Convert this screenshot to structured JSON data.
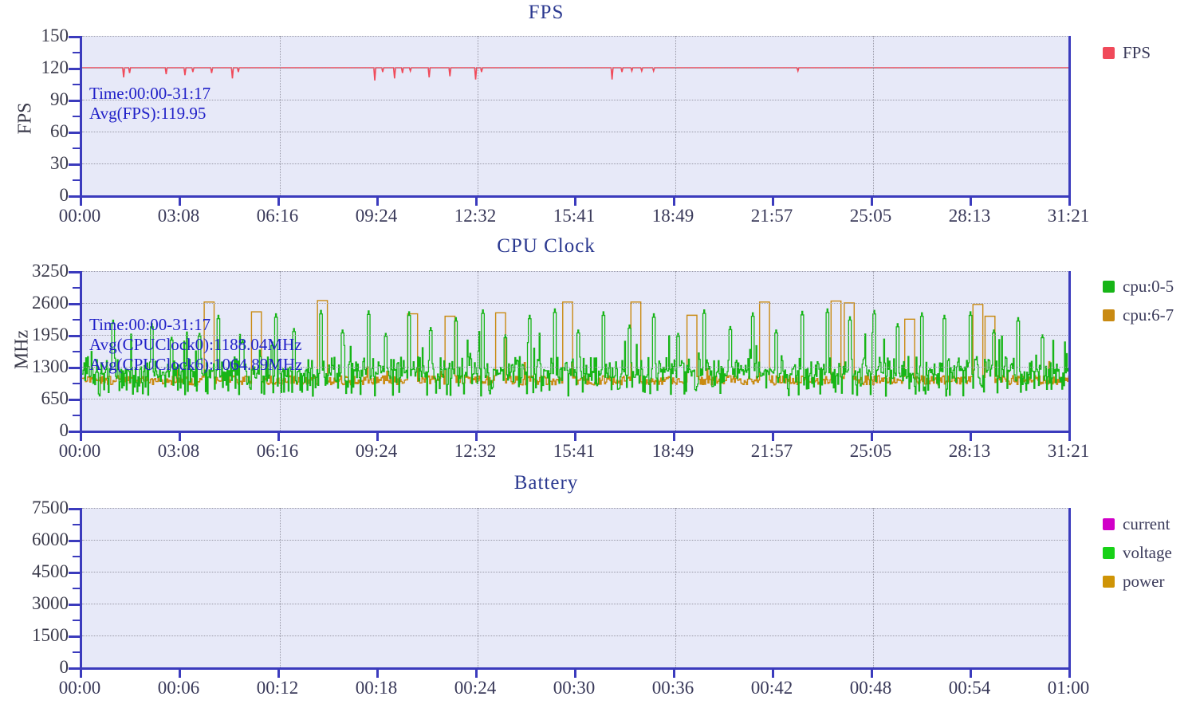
{
  "charts": [
    {
      "id": "fps",
      "title": "FPS",
      "ylabel": "FPS",
      "annotation": "Time:00:00-31:17\nAvg(FPS):119.95",
      "annotation_lines": [
        "Time:00:00-31:17",
        "Avg(FPS):119.95"
      ],
      "legend": [
        {
          "label": "FPS",
          "color": "#f04a5a"
        }
      ]
    },
    {
      "id": "cpu",
      "title": "CPU Clock",
      "ylabel": "MHz",
      "annotation": "Time:00:00-31:17\nAvg(CPUClock0):1188.04MHz\nAvg(CPUClock6):1064.89MHz",
      "annotation_lines": [
        "Time:00:00-31:17",
        "Avg(CPUClock0):1188.04MHz",
        "Avg(CPUClock6):1064.89MHz"
      ],
      "legend": [
        {
          "label": "cpu:0-5",
          "color": "#17b517"
        },
        {
          "label": "cpu:6-7",
          "color": "#c98a12"
        }
      ]
    },
    {
      "id": "battery",
      "title": "Battery",
      "ylabel": "",
      "annotation": "",
      "annotation_lines": [],
      "legend": [
        {
          "label": "current",
          "color": "#d100c8"
        },
        {
          "label": "voltage",
          "color": "#17d117"
        },
        {
          "label": "power",
          "color": "#cf9406"
        }
      ]
    }
  ],
  "chart_data": [
    {
      "type": "line",
      "id": "fps",
      "title": "FPS",
      "xlabel": "",
      "ylabel": "FPS",
      "ylim": [
        0,
        150
      ],
      "yticks": [
        0,
        30,
        60,
        90,
        120,
        150
      ],
      "ytick_labels": [
        "0",
        "30",
        "60",
        "90",
        "120",
        "150"
      ],
      "xtick_labels": [
        "00:00",
        "03:08",
        "06:16",
        "09:24",
        "12:32",
        "15:41",
        "18:49",
        "21:57",
        "25:05",
        "28:13",
        "31:21"
      ],
      "grid": true,
      "legend_position": "right",
      "annotations": [
        "Time:00:00-31:17",
        "Avg(FPS):119.95"
      ],
      "series": [
        {
          "name": "FPS",
          "color": "#f04a5a",
          "baseline": 120,
          "average": 119.95,
          "dips": [
            {
              "x": 0.042,
              "y": 111
            },
            {
              "x": 0.048,
              "y": 115
            },
            {
              "x": 0.085,
              "y": 114
            },
            {
              "x": 0.104,
              "y": 113
            },
            {
              "x": 0.112,
              "y": 116
            },
            {
              "x": 0.131,
              "y": 115
            },
            {
              "x": 0.152,
              "y": 110
            },
            {
              "x": 0.158,
              "y": 116
            },
            {
              "x": 0.296,
              "y": 108
            },
            {
              "x": 0.304,
              "y": 116
            },
            {
              "x": 0.316,
              "y": 110
            },
            {
              "x": 0.324,
              "y": 115
            },
            {
              "x": 0.332,
              "y": 117
            },
            {
              "x": 0.351,
              "y": 111
            },
            {
              "x": 0.372,
              "y": 112
            },
            {
              "x": 0.398,
              "y": 109
            },
            {
              "x": 0.404,
              "y": 116
            },
            {
              "x": 0.536,
              "y": 109
            },
            {
              "x": 0.546,
              "y": 116
            },
            {
              "x": 0.556,
              "y": 117
            },
            {
              "x": 0.566,
              "y": 117
            },
            {
              "x": 0.578,
              "y": 117
            },
            {
              "x": 0.724,
              "y": 117
            }
          ]
        }
      ]
    },
    {
      "type": "line",
      "id": "cpu",
      "title": "CPU Clock",
      "xlabel": "",
      "ylabel": "MHz",
      "ylim": [
        0,
        3250
      ],
      "yticks": [
        0,
        650,
        1300,
        1950,
        2600,
        3250
      ],
      "ytick_labels": [
        "0",
        "650",
        "1300",
        "1950",
        "2600",
        "3250"
      ],
      "xtick_labels": [
        "00:00",
        "03:08",
        "06:16",
        "09:24",
        "12:32",
        "15:41",
        "18:49",
        "21:57",
        "25:05",
        "28:13",
        "31:21"
      ],
      "grid": true,
      "legend_position": "right",
      "annotations": [
        "Time:00:00-31:17",
        "Avg(CPUClock0):1188.04MHz",
        "Avg(CPUClock6):1064.89MHz"
      ],
      "series": [
        {
          "name": "cpu:0-5",
          "color": "#17b517",
          "average": 1188.04,
          "base_level": 1150,
          "noise_min": 700,
          "noise_max": 1450,
          "spikes": [
            {
              "x": 0.031,
              "y": 2250
            },
            {
              "x": 0.07,
              "y": 2180
            },
            {
              "x": 0.09,
              "y": 1900
            },
            {
              "x": 0.118,
              "y": 1980
            },
            {
              "x": 0.137,
              "y": 2350
            },
            {
              "x": 0.162,
              "y": 1850
            },
            {
              "x": 0.196,
              "y": 2380
            },
            {
              "x": 0.214,
              "y": 2080
            },
            {
              "x": 0.241,
              "y": 2450
            },
            {
              "x": 0.263,
              "y": 2050
            },
            {
              "x": 0.289,
              "y": 2440
            },
            {
              "x": 0.307,
              "y": 1980
            },
            {
              "x": 0.33,
              "y": 2420
            },
            {
              "x": 0.352,
              "y": 2100
            },
            {
              "x": 0.378,
              "y": 2300
            },
            {
              "x": 0.405,
              "y": 2460
            },
            {
              "x": 0.428,
              "y": 1950
            },
            {
              "x": 0.452,
              "y": 2350
            },
            {
              "x": 0.478,
              "y": 2480
            },
            {
              "x": 0.501,
              "y": 2050
            },
            {
              "x": 0.527,
              "y": 2420
            },
            {
              "x": 0.553,
              "y": 2150
            },
            {
              "x": 0.578,
              "y": 2380
            },
            {
              "x": 0.602,
              "y": 1980
            },
            {
              "x": 0.629,
              "y": 2460
            },
            {
              "x": 0.655,
              "y": 2120
            },
            {
              "x": 0.678,
              "y": 2400
            },
            {
              "x": 0.702,
              "y": 2050
            },
            {
              "x": 0.728,
              "y": 2430
            },
            {
              "x": 0.753,
              "y": 2480
            },
            {
              "x": 0.776,
              "y": 2320
            },
            {
              "x": 0.801,
              "y": 2450
            },
            {
              "x": 0.824,
              "y": 2180
            },
            {
              "x": 0.849,
              "y": 2400
            },
            {
              "x": 0.872,
              "y": 2350
            },
            {
              "x": 0.898,
              "y": 2420
            },
            {
              "x": 0.922,
              "y": 2050
            },
            {
              "x": 0.946,
              "y": 2300
            },
            {
              "x": 0.971,
              "y": 1950
            }
          ]
        },
        {
          "name": "cpu:6-7",
          "color": "#c98a12",
          "average": 1064.89,
          "base_level": 1000,
          "noise_min": 930,
          "noise_max": 1120,
          "spikes": [
            {
              "x": 0.128,
              "y": 2620
            },
            {
              "x": 0.176,
              "y": 2420
            },
            {
              "x": 0.243,
              "y": 2650
            },
            {
              "x": 0.334,
              "y": 2380
            },
            {
              "x": 0.372,
              "y": 2330
            },
            {
              "x": 0.423,
              "y": 2400
            },
            {
              "x": 0.49,
              "y": 2620
            },
            {
              "x": 0.56,
              "y": 2620
            },
            {
              "x": 0.616,
              "y": 2350
            },
            {
              "x": 0.69,
              "y": 2620
            },
            {
              "x": 0.762,
              "y": 2640
            },
            {
              "x": 0.775,
              "y": 2600
            },
            {
              "x": 0.836,
              "y": 2270
            },
            {
              "x": 0.905,
              "y": 2570
            },
            {
              "x": 0.918,
              "y": 2330
            }
          ]
        }
      ]
    },
    {
      "type": "line",
      "id": "battery",
      "title": "Battery",
      "xlabel": "",
      "ylabel": "",
      "ylim": [
        0,
        7500
      ],
      "yticks": [
        0,
        1500,
        3000,
        4500,
        6000,
        7500
      ],
      "ytick_labels": [
        "0",
        "1500",
        "3000",
        "4500",
        "6000",
        "7500"
      ],
      "xtick_labels": [
        "00:00",
        "00:06",
        "00:12",
        "00:18",
        "00:24",
        "00:30",
        "00:36",
        "00:42",
        "00:48",
        "00:54",
        "01:00"
      ],
      "grid": true,
      "legend_position": "right",
      "annotations": [],
      "series": [
        {
          "name": "current",
          "color": "#d100c8",
          "values": []
        },
        {
          "name": "voltage",
          "color": "#17d117",
          "values": []
        },
        {
          "name": "power",
          "color": "#cf9406",
          "values": []
        }
      ]
    }
  ],
  "colors": {
    "plot_background": "#e7e9f8",
    "axis": "#3b3bbd",
    "grid": "#9a9aa8",
    "title": "#2b3990",
    "annotation": "#2020c8",
    "tick_text": "#3a3a5a"
  }
}
